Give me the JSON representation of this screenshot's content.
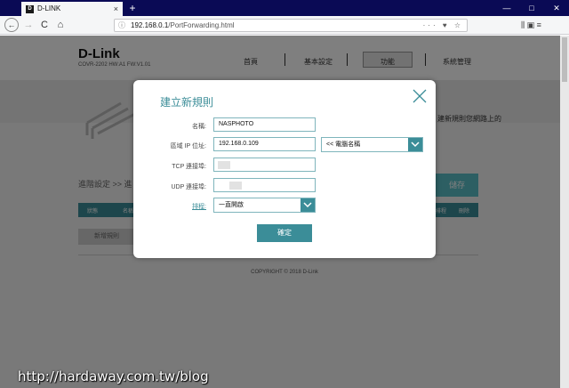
{
  "browser": {
    "tab_title": "D-LINK",
    "tab_favicon": "D",
    "tab_close": "×",
    "new_tab": "+",
    "back": "←",
    "forward": "→",
    "reload": "C",
    "home": "⌂",
    "url_host": "192.168.0.1",
    "url_path": "/PortForwarding.html",
    "url_actions": "··· ♥ ☆",
    "toolbar_right": "⫼ ▣ ≡",
    "window_controls": {
      "minimize": "—",
      "maximize": "□",
      "close": "✕"
    }
  },
  "page": {
    "logo": "D-Link",
    "model": "COVR-2202 HW:A1 FW:V1.01",
    "menu": [
      "首頁",
      "基本設定",
      "功能",
      "系統管理"
    ],
    "behind_text": "建新規則您網路上的",
    "breadcrumb": "進階設定 >> 進",
    "save_label": "儲存",
    "table_headers": [
      "狀態",
      "名稱",
      "排程",
      "刪除"
    ],
    "new_rule_label": "新增規則",
    "copyright": "COPYRIGHT © 2018 D-Link"
  },
  "modal": {
    "title": "建立新規則",
    "fields": {
      "name_label": "名稱:",
      "name_value": "NASPHOTO",
      "ip_label": "區域 IP 位址:",
      "ip_value": "192.168.0.109",
      "computer_select": "<< 電腦名稱",
      "tcp_label": "TCP 連接埠:",
      "udp_label": "UDP 連接埠:",
      "schedule_label": "排程:",
      "schedule_value": "一直開啟"
    },
    "confirm_label": "確定"
  },
  "watermark": "http://hardaway.com.tw/blog",
  "colors": {
    "accent": "#3b8d98",
    "titlebar": "#0a0a55",
    "save": "#5bbfc7"
  }
}
